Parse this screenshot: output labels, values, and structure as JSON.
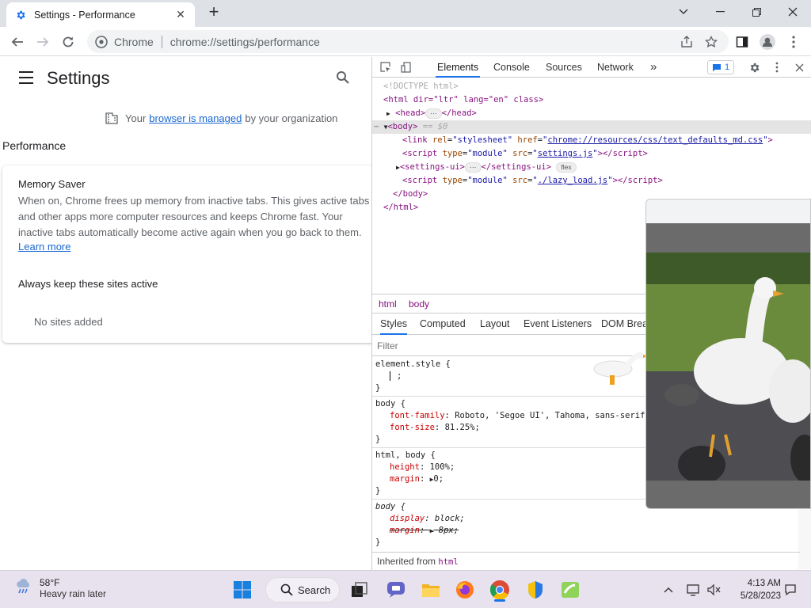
{
  "tab": {
    "title": "Settings - Performance"
  },
  "omnibox": {
    "site_label": "Chrome",
    "url": "chrome://settings/performance"
  },
  "settings": {
    "title": "Settings",
    "managed_prefix": "Your",
    "managed_link": "browser is managed",
    "managed_suffix": "by your organization",
    "section_heading": "Performance",
    "memory_saver_title": "Memory Saver",
    "memory_saver_desc": "When on, Chrome frees up memory from inactive tabs. This gives active tabs and other apps more computer resources and keeps Chrome fast. Your inactive tabs automatically become active again when you go back to them.",
    "learn_more": "Learn more",
    "keep_active_title": "Always keep these sites active",
    "no_sites": "No sites added"
  },
  "devtools": {
    "tabs": [
      "Elements",
      "Console",
      "Sources",
      "Network"
    ],
    "more": "»",
    "issues_count": "1",
    "dom": {
      "doctype": "<!DOCTYPE html>",
      "html_open": "<html dir=\"ltr\" lang=\"en\" class>",
      "head": "<head>",
      "head_close": "</head>",
      "body_sel": "== $0",
      "link_href": "chrome://resources/css/text_defaults_md.css",
      "script1_src": "settings.js",
      "settings_ui": "flex",
      "script2_src": "./lazy_load.js",
      "body_close": "</body>",
      "html_close": "</html>"
    },
    "breadcrumbs": [
      "html",
      "body"
    ],
    "subtabs": [
      "Styles",
      "Computed",
      "Layout",
      "Event Listeners",
      "DOM Breakpoints"
    ],
    "filter_placeholder": "Filter",
    "styles": {
      "r1_sel": "element.style {",
      "r1_body": ";",
      "r2_sel": "body {",
      "r2_p1": "font-family",
      "r2_v1": "Roboto, 'Segoe UI', Tahoma, sans-serif;",
      "r2_p2": "font-size",
      "r2_v2": "81.25%;",
      "r3_sel": "html, body {",
      "r3_p1": "height",
      "r3_v1": "100%;",
      "r3_p2": "margin",
      "r3_v2": "0;",
      "r4_sel": "body {",
      "r4_p1": "display",
      "r4_v1": "block;",
      "r4_p2": "margin",
      "r4_v2": "8px;",
      "close": "}"
    },
    "inherited_label": "Inherited from",
    "inherited_tag": "html"
  },
  "taskbar": {
    "temp": "58°F",
    "condition": "Heavy rain later",
    "search_label": "Search",
    "time": "4:13 AM",
    "date": "5/28/2023"
  },
  "colors": {
    "accent": "#1a73e8",
    "tag": "#881280",
    "attr": "#994500",
    "value": "#1a1aa6"
  }
}
